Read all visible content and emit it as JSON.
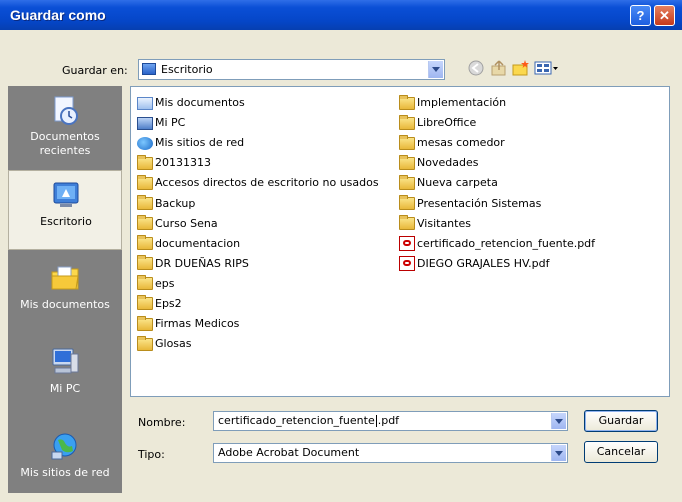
{
  "window": {
    "title": "Guardar como",
    "help_label": "?",
    "close_label": "✕"
  },
  "save_in": {
    "label": "Guardar en:",
    "value": "Escritorio"
  },
  "places": [
    {
      "label": "Documentos recientes",
      "icon": "recent-documents-icon"
    },
    {
      "label": "Escritorio",
      "icon": "desktop-icon",
      "selected": true
    },
    {
      "label": "Mis documentos",
      "icon": "my-documents-icon"
    },
    {
      "label": "Mi PC",
      "icon": "my-computer-icon"
    },
    {
      "label": "Mis sitios de red",
      "icon": "network-places-icon"
    }
  ],
  "files": {
    "col1": [
      {
        "name": "Mis documentos",
        "icon": "docs"
      },
      {
        "name": "Mi PC",
        "icon": "pc"
      },
      {
        "name": "Mis sitios de red",
        "icon": "net"
      },
      {
        "name": "20131313",
        "icon": "folder"
      },
      {
        "name": "Accesos directos de escritorio no usados",
        "icon": "folder"
      },
      {
        "name": "Backup",
        "icon": "folder"
      },
      {
        "name": "Curso Sena",
        "icon": "folder"
      },
      {
        "name": "documentacion",
        "icon": "folder"
      },
      {
        "name": "DR DUEÑAS RIPS",
        "icon": "folder"
      },
      {
        "name": "eps",
        "icon": "folder"
      },
      {
        "name": "Eps2",
        "icon": "folder"
      },
      {
        "name": "Firmas Medicos",
        "icon": "folder"
      },
      {
        "name": "Glosas",
        "icon": "folder"
      }
    ],
    "col2": [
      {
        "name": "Implementación",
        "icon": "folder"
      },
      {
        "name": "LibreOffice",
        "icon": "folder"
      },
      {
        "name": "mesas comedor",
        "icon": "folder"
      },
      {
        "name": "Novedades",
        "icon": "folder"
      },
      {
        "name": "Nueva carpeta",
        "icon": "folder"
      },
      {
        "name": "Presentación Sistemas",
        "icon": "folder"
      },
      {
        "name": "Visitantes",
        "icon": "folder"
      },
      {
        "name": "certificado_retencion_fuente.pdf",
        "icon": "pdf"
      },
      {
        "name": "DIEGO GRAJALES HV.pdf",
        "icon": "pdf"
      }
    ]
  },
  "filename": {
    "label": "Nombre:",
    "value_before_cursor": "certificado_retencion_fuente",
    "value_after_cursor": ".pdf"
  },
  "filetype": {
    "label": "Tipo:",
    "value": "Adobe Acrobat Document"
  },
  "buttons": {
    "save": "Guardar",
    "cancel": "Cancelar"
  }
}
